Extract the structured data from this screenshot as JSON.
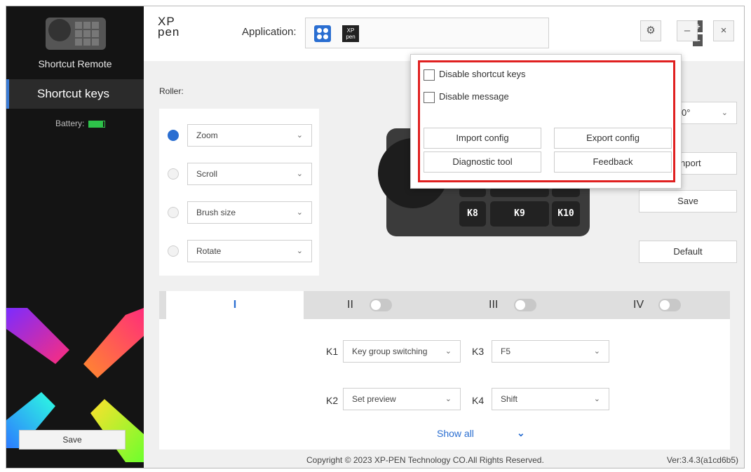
{
  "sidebar": {
    "device_title": "Shortcut Remote",
    "nav_item": "Shortcut keys",
    "battery_label": "Battery:",
    "battery_level": 1.0,
    "save_label": "Save"
  },
  "header": {
    "logo_line1": "XP",
    "logo_line2": "pen",
    "application_label": "Application:",
    "app_icon2_text": "XP pen",
    "plus": "+",
    "minus": "−",
    "settings_icon": "⚙",
    "minimize": "–",
    "close": "×"
  },
  "roller": {
    "label": "Roller:",
    "options": [
      {
        "label": "Zoom",
        "selected": true
      },
      {
        "label": "Scroll",
        "selected": false
      },
      {
        "label": "Brush size",
        "selected": false
      },
      {
        "label": "Rotate",
        "selected": false
      }
    ]
  },
  "device_keys": {
    "k8": "K8",
    "k9": "K9",
    "k10": "K10"
  },
  "right_panel": {
    "rotation_value": "0°",
    "import_partial": "nport",
    "save": "Save",
    "default": "Default"
  },
  "tabs": [
    {
      "label": "I",
      "active": true,
      "toggle_on": null
    },
    {
      "label": "II",
      "active": false,
      "toggle_on": false
    },
    {
      "label": "III",
      "active": false,
      "toggle_on": false
    },
    {
      "label": "IV",
      "active": false,
      "toggle_on": false
    }
  ],
  "key_assignments": {
    "k1": {
      "label": "K1",
      "value": "Key group switching"
    },
    "k2": {
      "label": "K2",
      "value": "Set preview"
    },
    "k3": {
      "label": "K3",
      "value": "F5"
    },
    "k4": {
      "label": "K4",
      "value": "Shift"
    },
    "show_all": "Show all"
  },
  "footer": {
    "copyright": "Copyright © 2023  XP-PEN Technology CO.All Rights Reserved.",
    "version": "Ver:3.4.3(a1cd6b5)"
  },
  "popup": {
    "disable_shortcut_keys": "Disable shortcut keys",
    "disable_message": "Disable message",
    "import_config": "Import config",
    "export_config": "Export config",
    "diagnostic_tool": "Diagnostic tool",
    "feedback": "Feedback",
    "highlight_color": "#e02020"
  },
  "colors": {
    "accent": "#2a6ed1",
    "sidebar_bg": "#141414",
    "battery": "#2ec24a"
  }
}
